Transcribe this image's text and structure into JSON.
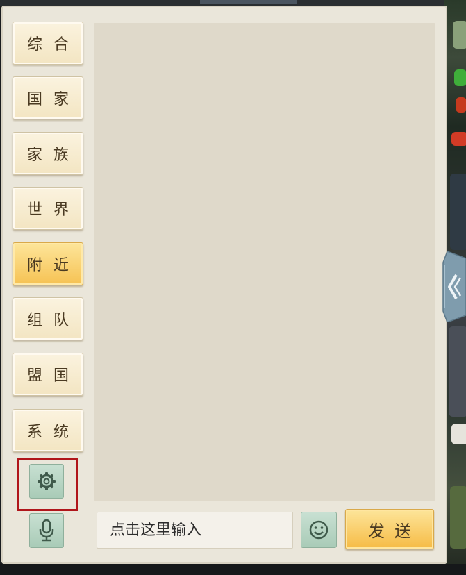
{
  "chat_panel": {
    "channels": [
      {
        "id": "comprehensive",
        "label": "综合",
        "active": false
      },
      {
        "id": "nation",
        "label": "国家",
        "active": false
      },
      {
        "id": "family",
        "label": "家族",
        "active": false
      },
      {
        "id": "world",
        "label": "世界",
        "active": false
      },
      {
        "id": "nearby",
        "label": "附近",
        "active": true
      },
      {
        "id": "team",
        "label": "组队",
        "active": false
      },
      {
        "id": "alliance",
        "label": "盟国",
        "active": false
      },
      {
        "id": "system",
        "label": "系统",
        "active": false
      }
    ],
    "settings_icon": "gear-icon",
    "voice_icon": "microphone-icon",
    "input": {
      "placeholder": "点击这里输入",
      "value": ""
    },
    "emoji_icon": "smiley-icon",
    "send_label": "发送",
    "collapse_icon": "chevron-left-icon"
  },
  "colors": {
    "panel_bg": "#eae6da",
    "chat_area_bg": "#dfd9ca",
    "active_channel": "#f6c253",
    "icon_button_bg": "#a9cbb7",
    "highlight": "#b0161b"
  }
}
